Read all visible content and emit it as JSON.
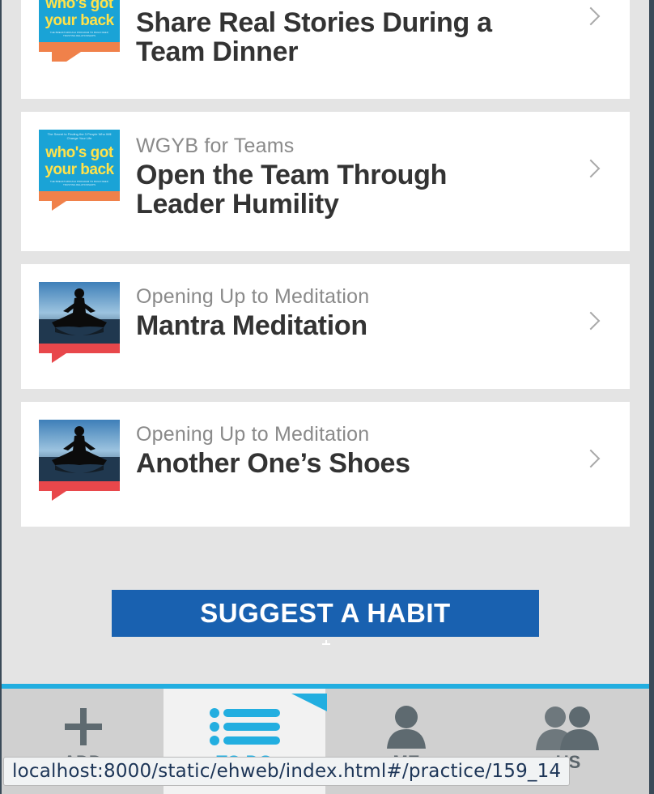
{
  "practices": [
    {
      "category": "",
      "title_lines": [
        "Share Real Stories During a",
        "Team Dinner"
      ],
      "thumbnail": "book-cover-whos-got-your-back",
      "accent_color": "#f0814a"
    },
    {
      "category": "WGYB for Teams",
      "title_lines": [
        "Open the Team Through",
        "Leader Humility"
      ],
      "thumbnail": "book-cover-whos-got-your-back",
      "accent_color": "#f0814a"
    },
    {
      "category": "Opening Up to Meditation",
      "title_lines": [
        "Mantra Meditation"
      ],
      "thumbnail": "meditation-silhouette",
      "accent_color": "#e8474b"
    },
    {
      "category": "Opening Up to Meditation",
      "title_lines": [
        "Another One’s Shoes"
      ],
      "thumbnail": "meditation-silhouette",
      "accent_color": "#e8474b"
    }
  ],
  "book_cover": {
    "line1": "who's got",
    "line2": "your back"
  },
  "suggest_button": {
    "label": "SUGGEST A HABIT"
  },
  "tabbar": {
    "tabs": [
      {
        "label": "ADD",
        "icon": "plus-icon"
      },
      {
        "label": "TO DO",
        "icon": "list-icon",
        "active": true
      },
      {
        "label": "ME",
        "icon": "person-icon"
      },
      {
        "label": "US",
        "icon": "people-icon"
      }
    ],
    "accent_color": "#22aee0"
  },
  "status_url": "localhost:8000/static/ehweb/index.html#/practice/159_14"
}
